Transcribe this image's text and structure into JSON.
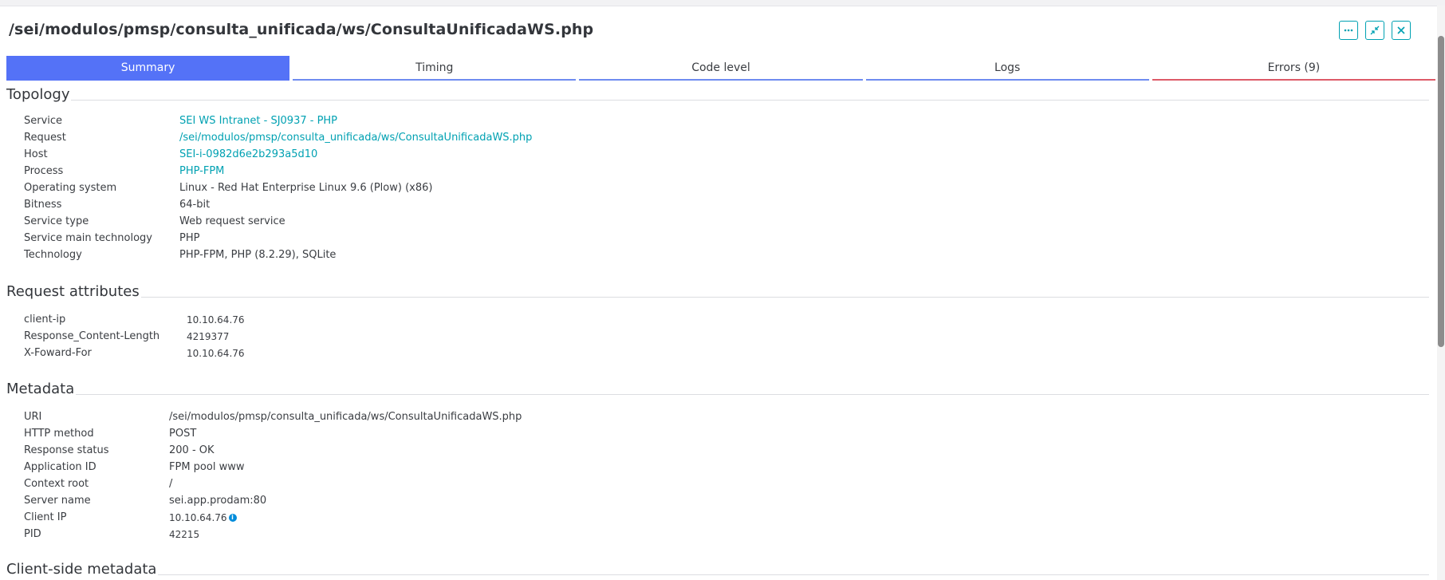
{
  "title": "/sei/modulos/pmsp/consulta_unificada/ws/ConsultaUnificadaWS.php",
  "window_buttons": [
    {
      "name": "more-button",
      "icon": "ellipsis-icon"
    },
    {
      "name": "collapse-button",
      "icon": "collapse-arrows-icon"
    },
    {
      "name": "close-button",
      "icon": "close-icon"
    }
  ],
  "tabs": [
    {
      "label": "Summary",
      "active": true
    },
    {
      "label": "Timing"
    },
    {
      "label": "Code level"
    },
    {
      "label": "Logs"
    },
    {
      "label": "Errors (9)"
    }
  ],
  "topology": {
    "title": "Topology",
    "rows": [
      {
        "key": "Service",
        "value": "SEI WS Intranet - SJ0937 - PHP",
        "link": true
      },
      {
        "key": "Request",
        "value": "/sei/modulos/pmsp/consulta_unificada/ws/ConsultaUnificadaWS.php",
        "link": true
      },
      {
        "key": "Host",
        "value": "SEI-i-0982d6e2b293a5d10",
        "link": true
      },
      {
        "key": "Process",
        "value": "PHP-FPM",
        "link": true
      },
      {
        "key": "Operating system",
        "value": "Linux - Red Hat Enterprise Linux 9.6 (Plow) (x86)"
      },
      {
        "key": "Bitness",
        "value": "64-bit"
      },
      {
        "key": "Service type",
        "value": "Web request service"
      },
      {
        "key": "Service main technology",
        "value": "PHP"
      },
      {
        "key": "Technology",
        "value": "PHP-FPM, PHP (8.2.29), SQLite"
      }
    ]
  },
  "request_attributes": {
    "title": "Request attributes",
    "rows": [
      {
        "key": "client-ip",
        "value": "10.10.64.76"
      },
      {
        "key": "Response_Content-Length",
        "value": "4219377"
      },
      {
        "key": "X-Foward-For",
        "value": "10.10.64.76"
      }
    ]
  },
  "metadata": {
    "title": "Metadata",
    "rows": [
      {
        "key": "URI",
        "value": "/sei/modulos/pmsp/consulta_unificada/ws/ConsultaUnificadaWS.php"
      },
      {
        "key": "HTTP method",
        "value": "POST"
      },
      {
        "key": "Response status",
        "value": "200 - OK"
      },
      {
        "key": "Application ID",
        "value": "FPM pool www"
      },
      {
        "key": "Context root",
        "value": "/"
      },
      {
        "key": "Server name",
        "value": "sei.app.prodam:80"
      },
      {
        "key": "Client IP",
        "value": "10.10.64.76",
        "info_icon": "i"
      },
      {
        "key": "PID",
        "value": "42215"
      }
    ]
  },
  "client_side_metadata": {
    "title": "Client-side metadata"
  }
}
